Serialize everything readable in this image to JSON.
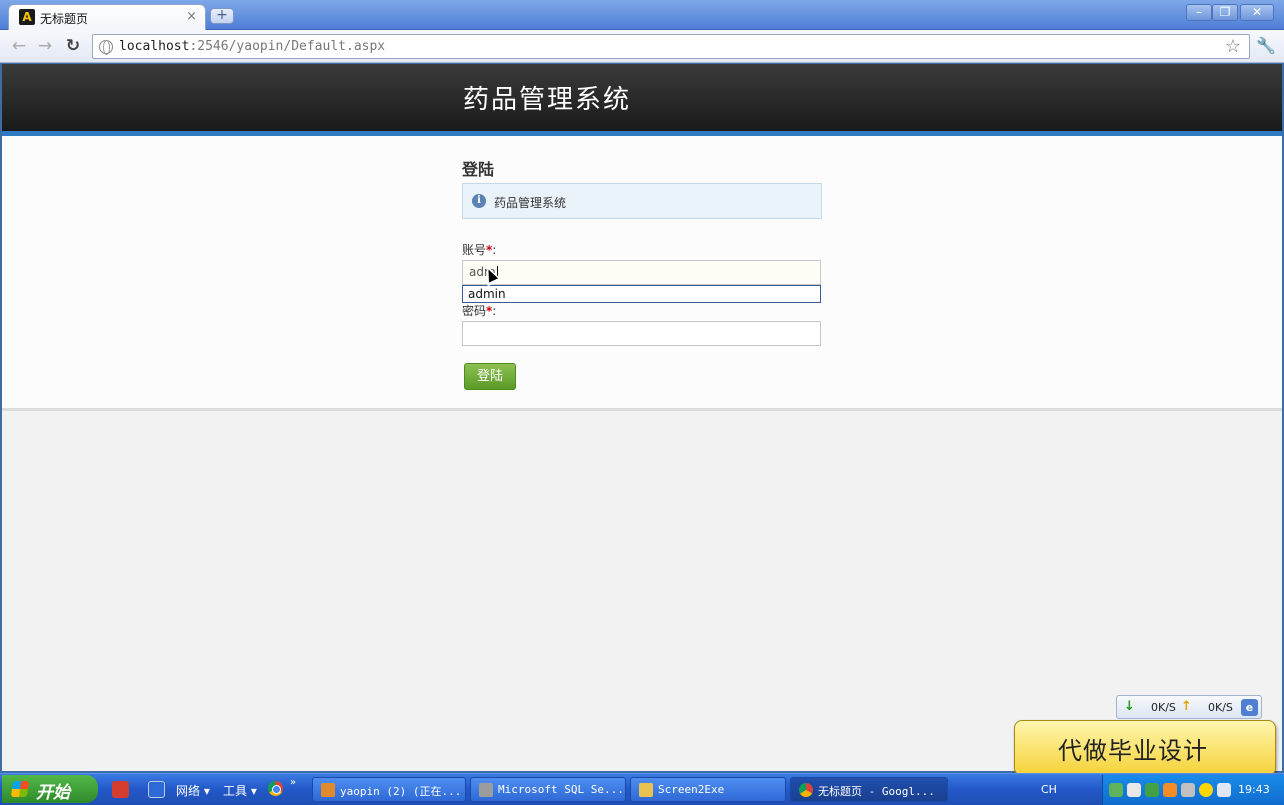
{
  "browser": {
    "tab_title": "无标题页",
    "tab_favicon": "A",
    "tab_close": "×",
    "new_tab": "+",
    "window_controls": {
      "minimize": "–",
      "maximize": "❐",
      "close": "✕"
    },
    "nav": {
      "back": "←",
      "forward": "→",
      "reload": "↻"
    },
    "url_host": "localhost",
    "url_path": ":2546/yaopin/Default.aspx",
    "bookmark_star": "☆",
    "wrench": "🔧"
  },
  "page": {
    "site_title": "药品管理系统",
    "login_heading": "登陆",
    "notice_text": "药品管理系统",
    "info_icon": "i",
    "account_label": "账号",
    "password_label": "密码",
    "required_mark": "*",
    "label_colon": ":",
    "account_value": "adm",
    "password_value": "",
    "autocomplete_suggestion": "admin",
    "login_button": "登陆"
  },
  "overlay": {
    "download_speed": "0K/S",
    "upload_speed": "0K/S",
    "down_arrow": "↓",
    "up_arrow": "↑",
    "ie_glyph": "e",
    "promo_text": "代做毕业设计"
  },
  "taskbar": {
    "start_label": "开始",
    "menu_network": "网络 ▾",
    "menu_tools": "工具 ▾",
    "more": "»",
    "tasks": [
      {
        "label": "yaopin (2) (正在..."
      },
      {
        "label": "Microsoft SQL Se..."
      },
      {
        "label": "Screen2Exe"
      },
      {
        "label": "无标题页 - Googl..."
      }
    ],
    "language": "CH",
    "clock": "19:43"
  },
  "colors": {
    "header_bg": "#1f1f1f",
    "header_accent": "#2e7bc4",
    "login_button": "#6aa935",
    "required": "#cc0000",
    "promo_bg": "#f5d237"
  }
}
